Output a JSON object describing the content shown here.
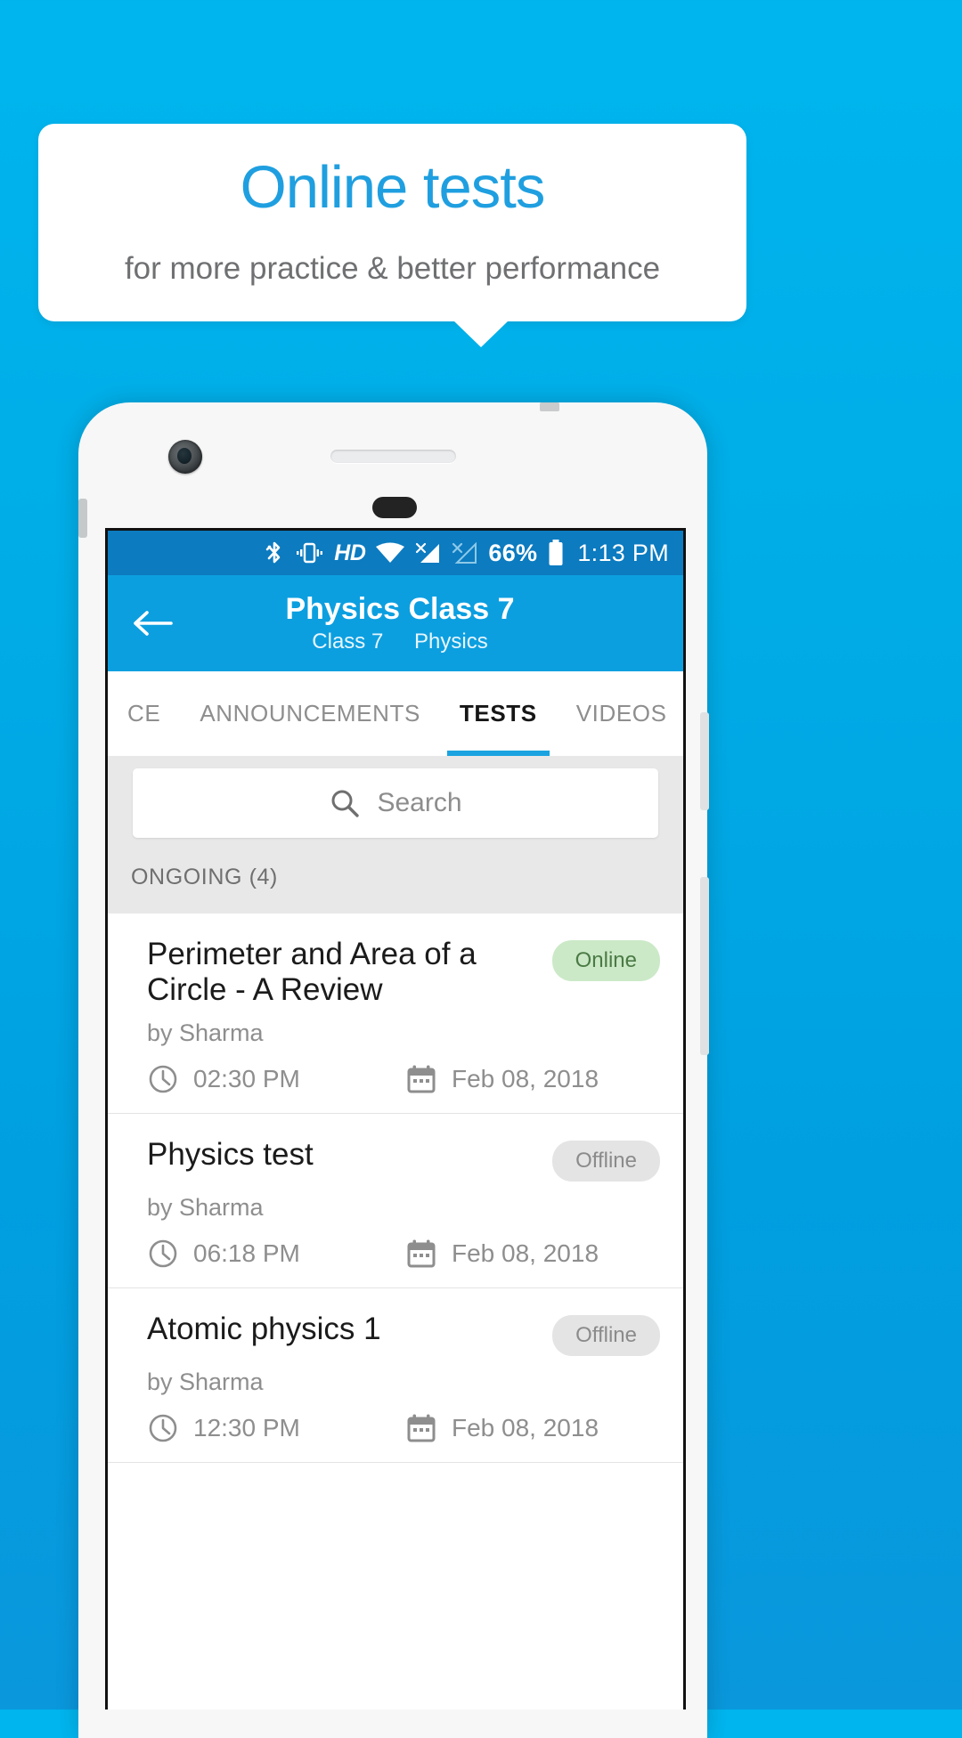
{
  "promo": {
    "title": "Online tests",
    "subtitle": "for more practice & better performance",
    "title_color": "#1f9fe0",
    "subtitle_color": "#6f7072",
    "background_color": "#00ace6"
  },
  "statusbar": {
    "icons": [
      "bluetooth-icon",
      "vibrate-icon",
      "hd-icon",
      "wifi-icon",
      "signal-sim1-icon",
      "signal-sim2-icon"
    ],
    "hd_label": "HD",
    "battery_percent": "66%",
    "time": "1:13 PM",
    "background_color": "#0c7bc0"
  },
  "appbar": {
    "back_icon": "back-arrow-icon",
    "title": "Physics Class 7",
    "subtitle_class": "Class 7",
    "subtitle_subject": "Physics",
    "background_color": "#0c9fe0"
  },
  "tabs": {
    "items": [
      {
        "label": "CE",
        "active": false
      },
      {
        "label": "ANNOUNCEMENTS",
        "active": false
      },
      {
        "label": "TESTS",
        "active": true
      },
      {
        "label": "VIDEOS",
        "active": false
      }
    ],
    "indicator_color": "#1aa3e0"
  },
  "search": {
    "placeholder": "Search",
    "icon": "search-icon",
    "value": ""
  },
  "section": {
    "label": "ONGOING (4)"
  },
  "tests": [
    {
      "title": "Perimeter and Area of a Circle - A Review",
      "author": "by Sharma",
      "status": "Online",
      "status_type": "online",
      "time": "02:30 PM",
      "date": "Feb 08, 2018"
    },
    {
      "title": "Physics test",
      "author": "by Sharma",
      "status": "Offline",
      "status_type": "offline",
      "time": "06:18 PM",
      "date": "Feb 08, 2018"
    },
    {
      "title": "Atomic physics 1",
      "author": "by Sharma",
      "status": "Offline",
      "status_type": "offline",
      "time": "12:30 PM",
      "date": "Feb 08, 2018"
    }
  ],
  "colors": {
    "badge_online_bg": "#cbe9c7",
    "badge_online_fg": "#4b7a45",
    "badge_offline_bg": "#e4e4e4",
    "badge_offline_fg": "#8b8b8b"
  }
}
